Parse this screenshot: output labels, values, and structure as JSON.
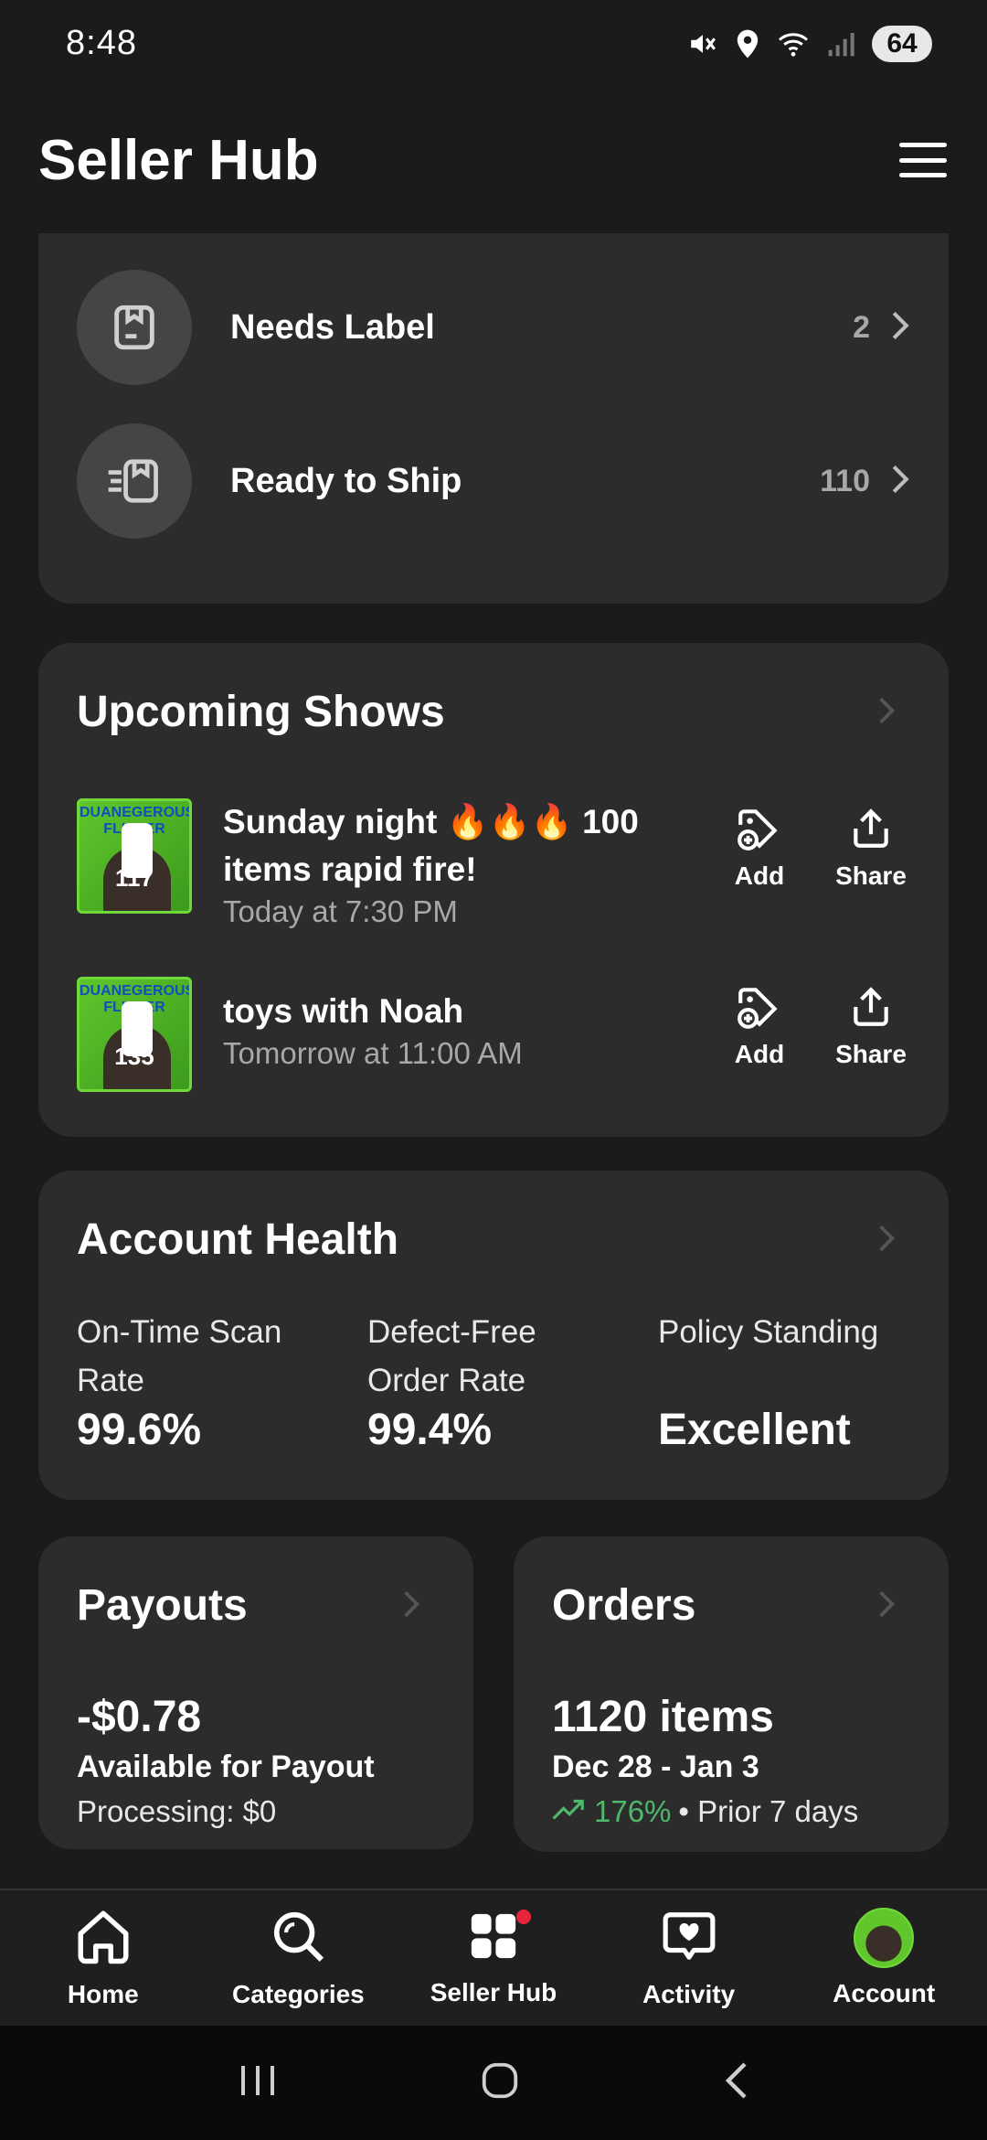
{
  "status_bar": {
    "time": "8:48",
    "battery": "64",
    "icons": [
      "mute-icon",
      "location-icon",
      "wifi-icon",
      "signal-icon"
    ]
  },
  "header": {
    "title": "Seller Hub",
    "menu_icon": "hamburger-menu-icon"
  },
  "shipping": {
    "items": [
      {
        "label": "Needs Label",
        "count": "2",
        "icon": "label-box-icon"
      },
      {
        "label": "Ready to Ship",
        "count": "110",
        "icon": "fast-box-icon"
      }
    ]
  },
  "upcoming_shows": {
    "title": "Upcoming Shows",
    "shows": [
      {
        "title": "Sunday night 🔥🔥🔥 100 items rapid fire!",
        "time": "Today at 7:30 PM",
        "viewers": "117",
        "brand": "DUANEGEROUS FLIPPER",
        "add_label": "Add",
        "share_label": "Share"
      },
      {
        "title": "toys with Noah",
        "time": "Tomorrow at 11:00 AM",
        "viewers": "135",
        "brand": "DUANEGEROUS FLIPPER",
        "add_label": "Add",
        "share_label": "Share"
      }
    ]
  },
  "account_health": {
    "title": "Account Health",
    "metrics": [
      {
        "label": "On-Time Scan Rate",
        "value": "99.6%"
      },
      {
        "label": "Defect-Free Order Rate",
        "value": "99.4%"
      },
      {
        "label": "Policy Standing",
        "value": "Excellent"
      }
    ]
  },
  "payouts": {
    "title": "Payouts",
    "amount": "-$0.78",
    "available_label": "Available for Payout",
    "processing": "Processing: $0"
  },
  "orders": {
    "title": "Orders",
    "count": "1120 items",
    "date_range": "Dec 28 - Jan 3",
    "trend_pct": "176%",
    "trend_suffix": "• Prior 7 days",
    "trend_color": "#4fb86b"
  },
  "bottom_nav": {
    "items": [
      {
        "label": "Home",
        "icon": "home-icon"
      },
      {
        "label": "Categories",
        "icon": "search-icon"
      },
      {
        "label": "Seller Hub",
        "icon": "grid-icon"
      },
      {
        "label": "Activity",
        "icon": "heart-chat-icon"
      },
      {
        "label": "Account",
        "icon": "avatar"
      }
    ]
  },
  "colors": {
    "background": "#1b1b1b",
    "card": "#2c2c2c",
    "accent_red": "#e8243a",
    "trend_green": "#4fb86b"
  }
}
